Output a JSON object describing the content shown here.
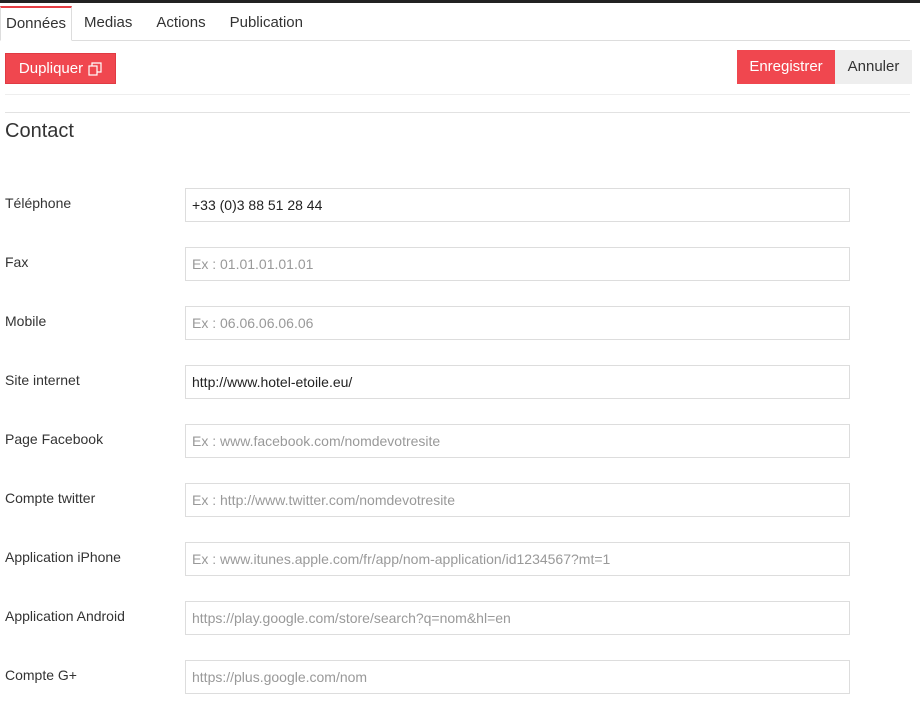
{
  "tabs": [
    {
      "label": "Données"
    },
    {
      "label": "Medias"
    },
    {
      "label": "Actions"
    },
    {
      "label": "Publication"
    }
  ],
  "toolbar": {
    "duplicate_label": "Dupliquer",
    "save_label": "Enregistrer",
    "cancel_label": "Annuler",
    "accent_color": "#f0474f"
  },
  "section": {
    "title": "Contact"
  },
  "fields": [
    {
      "label": "Téléphone",
      "value": "+33 (0)3 88 51 28 44",
      "placeholder": ""
    },
    {
      "label": "Fax",
      "value": "",
      "placeholder": "Ex : 01.01.01.01.01"
    },
    {
      "label": "Mobile",
      "value": "",
      "placeholder": "Ex : 06.06.06.06.06"
    },
    {
      "label": "Site internet",
      "value": "http://www.hotel-etoile.eu/",
      "placeholder": ""
    },
    {
      "label": "Page Facebook",
      "value": "",
      "placeholder": "Ex : www.facebook.com/nomdevotresite"
    },
    {
      "label": "Compte twitter",
      "value": "",
      "placeholder": "Ex : http://www.twitter.com/nomdevotresite"
    },
    {
      "label": "Application iPhone",
      "value": "",
      "placeholder": "Ex : www.itunes.apple.com/fr/app/nom-application/id1234567?mt=1"
    },
    {
      "label": "Application Android",
      "value": "",
      "placeholder": "https://play.google.com/store/search?q=nom&hl=en"
    },
    {
      "label": "Compte G+",
      "value": "",
      "placeholder": "https://plus.google.com/nom"
    }
  ]
}
